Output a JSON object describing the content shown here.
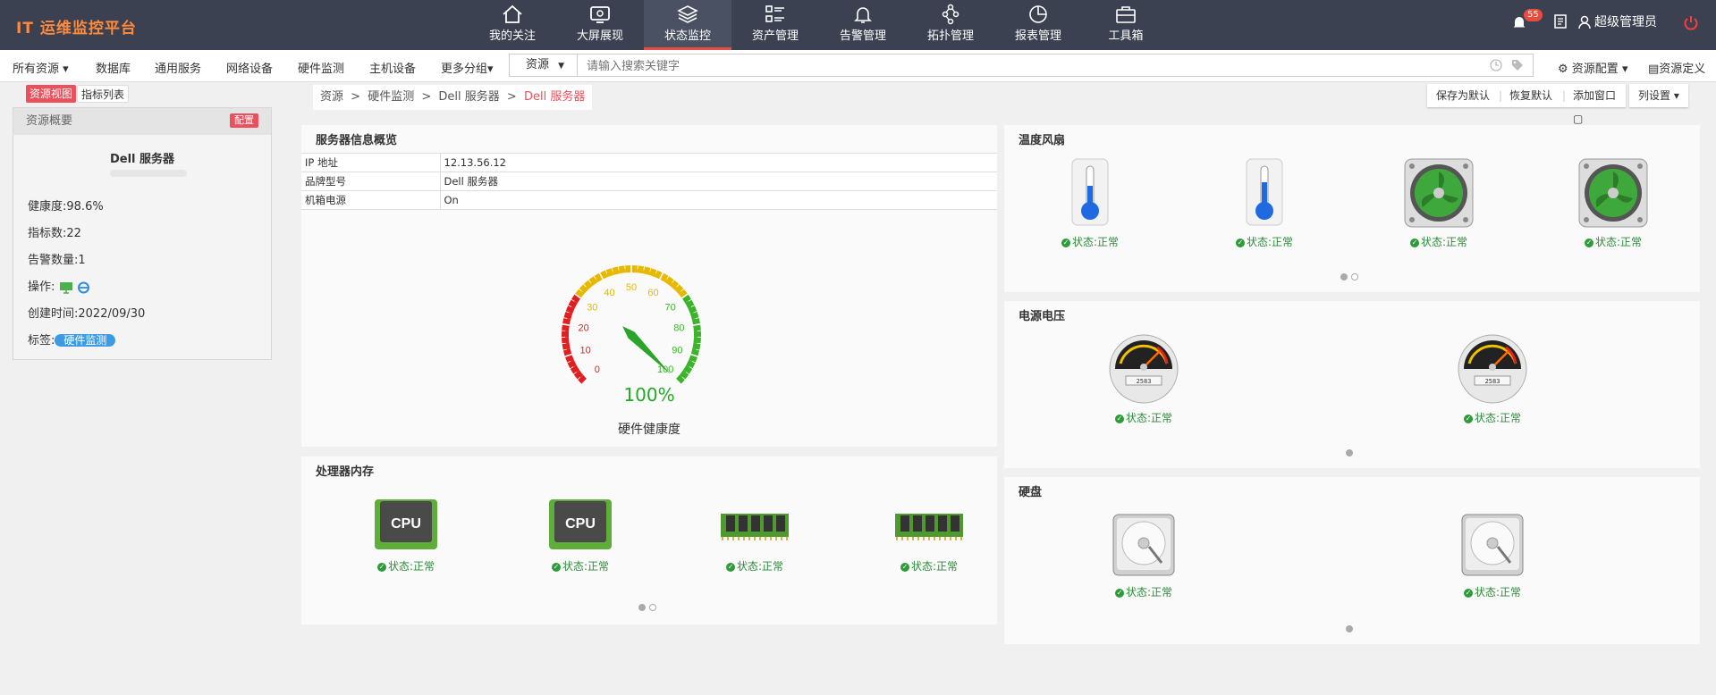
{
  "app": {
    "title": "IT 运维监控平台"
  },
  "nav": [
    {
      "label": "我的关注",
      "icon": "home-icon"
    },
    {
      "label": "大屏展现",
      "icon": "monitor-icon"
    },
    {
      "label": "状态监控",
      "icon": "layers-icon",
      "active": true
    },
    {
      "label": "资产管理",
      "icon": "list-icon"
    },
    {
      "label": "告警管理",
      "icon": "bell-icon"
    },
    {
      "label": "拓扑管理",
      "icon": "topology-icon"
    },
    {
      "label": "报表管理",
      "icon": "pie-chart-icon"
    },
    {
      "label": "工具箱",
      "icon": "toolbox-icon"
    }
  ],
  "header": {
    "notify_count": "55",
    "user": "超级管理员"
  },
  "subnav": {
    "all": "所有资源",
    "items": [
      "数据库",
      "通用服务",
      "网络设备",
      "硬件监测",
      "主机设备",
      "更多分组"
    ]
  },
  "search": {
    "type": "资源",
    "placeholder": "请输入搜索关键字"
  },
  "rightnav": {
    "config": "资源配置",
    "define": "资源定义"
  },
  "tabs": {
    "view": "资源视图",
    "list": "指标列表"
  },
  "overview": {
    "header": "资源概要",
    "config_btn": "配置",
    "name": "Dell 服务器",
    "health_label": "健康度:",
    "health": "98.6%",
    "metrics_label": "指标数:",
    "metrics": "22",
    "alerts_label": "告警数量:",
    "alerts": "1",
    "ops_label": "操作:",
    "created_label": "创建时间:",
    "created": "2022/09/30",
    "tag_label": "标签:",
    "tag": "硬件监测"
  },
  "breadcrumb": {
    "c1": "资源",
    "c2": "硬件监测",
    "c3": "Dell 服务器",
    "c4": "Dell 服务器",
    "sep": ">"
  },
  "actions": {
    "save": "保存为默认",
    "restore": "恢复默认",
    "add": "添加窗口",
    "cols": "列设置"
  },
  "server_info": {
    "title": "服务器信息概览",
    "rows": [
      {
        "k": "IP 地址",
        "v": "12.13.56.12"
      },
      {
        "k": "品牌型号",
        "v": "Dell 服务器"
      },
      {
        "k": "机箱电源",
        "v": "On"
      }
    ],
    "gauge": {
      "value": "100%",
      "label": "硬件健康度",
      "level": 100,
      "ticks": [
        "0",
        "10",
        "20",
        "30",
        "40",
        "50",
        "60",
        "70",
        "80",
        "90",
        "100"
      ]
    }
  },
  "status_text": "状态:正常",
  "temp_fan": {
    "title": "温度风扇"
  },
  "power": {
    "title": "电源电压",
    "meter_digits": "2583"
  },
  "cpu_mem": {
    "title": "处理器内存",
    "cpu_label": "CPU"
  },
  "disk": {
    "title": "硬盘"
  },
  "colors": {
    "accent": "#e74c3c",
    "topbar": "#3b4150",
    "ok": "#2e9b3a",
    "tag": "#3d9be3"
  }
}
